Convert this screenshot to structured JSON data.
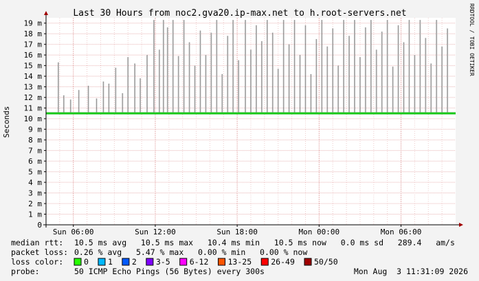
{
  "title": "Last 30 Hours from noc2.gva20.ip-max.net to h.root-servers.net",
  "watermark": "RRDTOOL / TOBI OETIKER",
  "colors": {
    "background": "#f3f3f3",
    "plot_background": "#ffffff",
    "grid": "#e8b4b4",
    "axis": "#000000",
    "smoke": "#b9b9b9",
    "arrow": "#a00000"
  },
  "chart_data": {
    "type": "line",
    "title": "Last 30 Hours from noc2.gva20.ip-max.net to h.root-servers.net",
    "xlabel": "",
    "ylabel": "Seconds",
    "ylim": [
      0,
      0.0195
    ],
    "y_ticks": [
      {
        "value": 0,
        "label": "0"
      },
      {
        "value": 0.001,
        "label": "1 m"
      },
      {
        "value": 0.002,
        "label": "2 m"
      },
      {
        "value": 0.003,
        "label": "3 m"
      },
      {
        "value": 0.004,
        "label": "4 m"
      },
      {
        "value": 0.005,
        "label": "5 m"
      },
      {
        "value": 0.006,
        "label": "6 m"
      },
      {
        "value": 0.007,
        "label": "7 m"
      },
      {
        "value": 0.008,
        "label": "8 m"
      },
      {
        "value": 0.009,
        "label": "9 m"
      },
      {
        "value": 0.01,
        "label": "10 m"
      },
      {
        "value": 0.011,
        "label": "11 m"
      },
      {
        "value": 0.012,
        "label": "12 m"
      },
      {
        "value": 0.013,
        "label": "13 m"
      },
      {
        "value": 0.014,
        "label": "14 m"
      },
      {
        "value": 0.015,
        "label": "15 m"
      },
      {
        "value": 0.016,
        "label": "16 m"
      },
      {
        "value": 0.017,
        "label": "17 m"
      },
      {
        "value": 0.018,
        "label": "18 m"
      },
      {
        "value": 0.019,
        "label": "19 m"
      }
    ],
    "x_range_hours": [
      0,
      30
    ],
    "x_ticks": [
      {
        "hour": 2,
        "label": "Sun 06:00"
      },
      {
        "hour": 8,
        "label": "Sun 12:00"
      },
      {
        "hour": 14,
        "label": "Sun 18:00"
      },
      {
        "hour": 20,
        "label": "Mon 00:00"
      },
      {
        "hour": 26,
        "label": "Mon 06:00"
      }
    ],
    "median_rtt_s": 0.0105,
    "series": [
      {
        "name": "median rtt",
        "color": "#22cc22",
        "value": 0.0105
      }
    ],
    "smoke_spikes": [
      {
        "hour": 0.9,
        "max": 0.0153
      },
      {
        "hour": 1.3,
        "max": 0.0122
      },
      {
        "hour": 1.8,
        "max": 0.0118
      },
      {
        "hour": 2.4,
        "max": 0.0127
      },
      {
        "hour": 3.1,
        "max": 0.0131
      },
      {
        "hour": 3.7,
        "max": 0.0119
      },
      {
        "hour": 4.2,
        "max": 0.0135
      },
      {
        "hour": 4.6,
        "max": 0.0133
      },
      {
        "hour": 5.1,
        "max": 0.0148
      },
      {
        "hour": 5.6,
        "max": 0.0124
      },
      {
        "hour": 6.0,
        "max": 0.0158
      },
      {
        "hour": 6.5,
        "max": 0.0152
      },
      {
        "hour": 6.9,
        "max": 0.0138
      },
      {
        "hour": 7.4,
        "max": 0.016
      },
      {
        "hour": 7.9,
        "max": 0.0193
      },
      {
        "hour": 8.3,
        "max": 0.0165
      },
      {
        "hour": 8.6,
        "max": 0.0193
      },
      {
        "hour": 8.9,
        "max": 0.0186
      },
      {
        "hour": 9.3,
        "max": 0.0193
      },
      {
        "hour": 9.7,
        "max": 0.0159
      },
      {
        "hour": 10.1,
        "max": 0.0193
      },
      {
        "hour": 10.5,
        "max": 0.0172
      },
      {
        "hour": 10.9,
        "max": 0.015
      },
      {
        "hour": 11.3,
        "max": 0.0183
      },
      {
        "hour": 11.7,
        "max": 0.016
      },
      {
        "hour": 12.1,
        "max": 0.0181
      },
      {
        "hour": 12.5,
        "max": 0.0193
      },
      {
        "hour": 12.9,
        "max": 0.0142
      },
      {
        "hour": 13.3,
        "max": 0.0178
      },
      {
        "hour": 13.7,
        "max": 0.0193
      },
      {
        "hour": 14.1,
        "max": 0.0155
      },
      {
        "hour": 14.6,
        "max": 0.0193
      },
      {
        "hour": 15.0,
        "max": 0.0165
      },
      {
        "hour": 15.4,
        "max": 0.0188
      },
      {
        "hour": 15.8,
        "max": 0.0173
      },
      {
        "hour": 16.2,
        "max": 0.0193
      },
      {
        "hour": 16.6,
        "max": 0.0181
      },
      {
        "hour": 17.0,
        "max": 0.0147
      },
      {
        "hour": 17.4,
        "max": 0.0193
      },
      {
        "hour": 17.8,
        "max": 0.017
      },
      {
        "hour": 18.2,
        "max": 0.0193
      },
      {
        "hour": 18.6,
        "max": 0.016
      },
      {
        "hour": 19.0,
        "max": 0.0188
      },
      {
        "hour": 19.4,
        "max": 0.0142
      },
      {
        "hour": 19.8,
        "max": 0.0175
      },
      {
        "hour": 20.2,
        "max": 0.0193
      },
      {
        "hour": 20.6,
        "max": 0.0168
      },
      {
        "hour": 21.0,
        "max": 0.0185
      },
      {
        "hour": 21.4,
        "max": 0.015
      },
      {
        "hour": 21.8,
        "max": 0.0193
      },
      {
        "hour": 22.2,
        "max": 0.0178
      },
      {
        "hour": 22.6,
        "max": 0.0193
      },
      {
        "hour": 23.0,
        "max": 0.0158
      },
      {
        "hour": 23.4,
        "max": 0.0186
      },
      {
        "hour": 23.8,
        "max": 0.0193
      },
      {
        "hour": 24.2,
        "max": 0.0165
      },
      {
        "hour": 24.6,
        "max": 0.0182
      },
      {
        "hour": 25.0,
        "max": 0.0193
      },
      {
        "hour": 25.4,
        "max": 0.0149
      },
      {
        "hour": 25.8,
        "max": 0.0188
      },
      {
        "hour": 26.2,
        "max": 0.0172
      },
      {
        "hour": 26.6,
        "max": 0.0193
      },
      {
        "hour": 27.0,
        "max": 0.016
      },
      {
        "hour": 27.4,
        "max": 0.0193
      },
      {
        "hour": 27.8,
        "max": 0.0176
      },
      {
        "hour": 28.2,
        "max": 0.0152
      },
      {
        "hour": 28.6,
        "max": 0.0193
      },
      {
        "hour": 29.0,
        "max": 0.0168
      },
      {
        "hour": 29.4,
        "max": 0.0185
      }
    ],
    "grid": true,
    "legend_position": "bottom"
  },
  "stats": {
    "median_rtt": {
      "label": "median rtt:",
      "text": "10.5 ms avg   10.5 ms max   10.4 ms min   10.5 ms now   0.0 ms sd   289.4   am/s"
    },
    "packet_loss": {
      "label": "packet loss:",
      "text": "0.26 % avg   5.47 % max   0.00 % min   0.00 % now"
    },
    "probe": {
      "label": "probe:",
      "text": "50 ICMP Echo Pings (56 Bytes) every 300s"
    },
    "timestamp": "Mon Aug  3 11:31:09 2026"
  },
  "loss_legend": {
    "label": "loss color:",
    "items": [
      {
        "label": "0",
        "color": "#26ff00"
      },
      {
        "label": "1",
        "color": "#00b8ff"
      },
      {
        "label": "2",
        "color": "#0059ff"
      },
      {
        "label": "3-5",
        "color": "#7e00ff"
      },
      {
        "label": "6-12",
        "color": "#ff00ff"
      },
      {
        "label": "13-25",
        "color": "#ff5500"
      },
      {
        "label": "26-49",
        "color": "#ff0000"
      },
      {
        "label": "50/50",
        "color": "#a10000"
      }
    ]
  }
}
